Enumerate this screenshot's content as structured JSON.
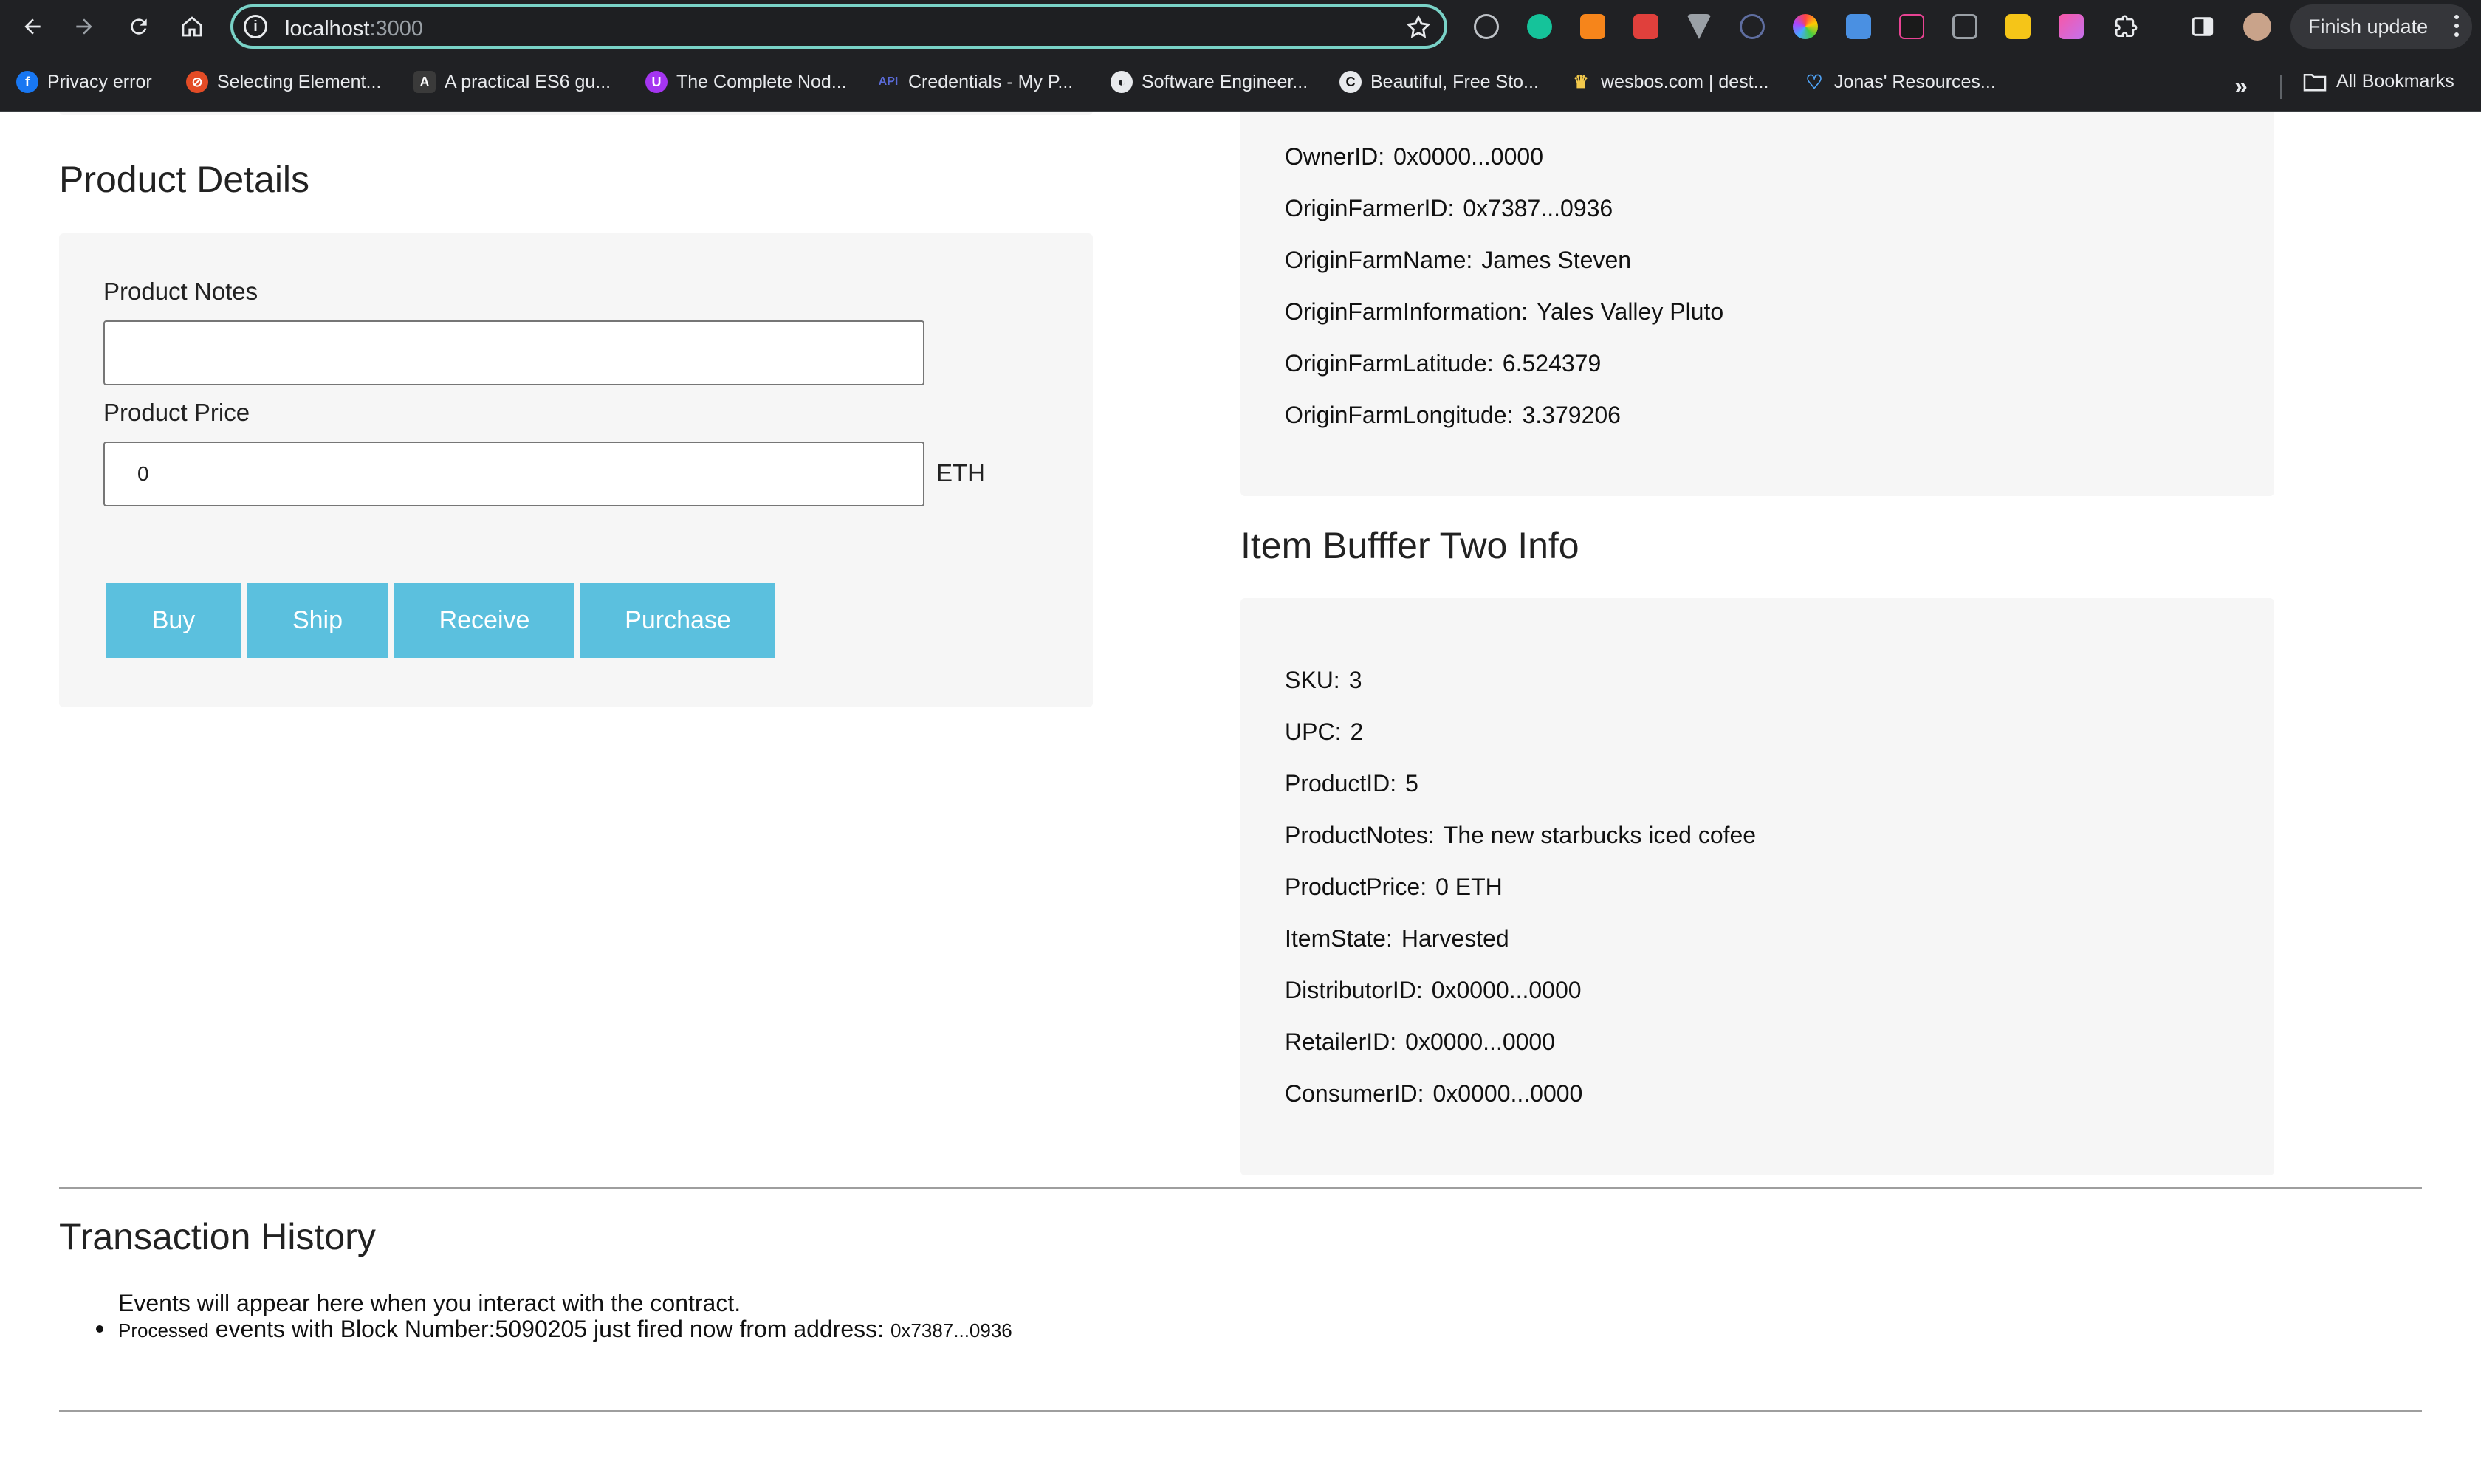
{
  "browser": {
    "url_host": "localhost",
    "url_port": ":3000",
    "finish_update_label": "Finish update",
    "bookmarks": [
      {
        "label": "Privacy error",
        "icon": "facebook-icon",
        "color": "#1877f2"
      },
      {
        "label": "Selecting Element...",
        "icon": "site-icon",
        "color": "#e34c26"
      },
      {
        "label": "A practical ES6 gu...",
        "icon": "site-icon",
        "color": "#3a3a3a"
      },
      {
        "label": "The Complete Nod...",
        "icon": "udemy-icon",
        "color": "#a435f0"
      },
      {
        "label": "Credentials - My P...",
        "icon": "api-icon",
        "color": "#5a6bd8"
      },
      {
        "label": "Software Engineer...",
        "icon": "globe-icon",
        "color": "#e8eaed"
      },
      {
        "label": "Beautiful, Free Sto...",
        "icon": "site-icon",
        "color": "#111111"
      },
      {
        "label": "wesbos.com | dest...",
        "icon": "crown-icon",
        "color": "#f2c94c"
      },
      {
        "label": "Jonas' Resources...",
        "icon": "heart-icon",
        "color": "#4fa3f7"
      }
    ],
    "all_bookmarks_label": "All Bookmarks"
  },
  "product_details": {
    "title": "Product Details",
    "notes_label": "Product Notes",
    "notes_value": "",
    "price_label": "Product Price",
    "price_value": "0",
    "price_unit": "ETH",
    "buttons": {
      "buy": "Buy",
      "ship": "Ship",
      "receive": "Receive",
      "purchase": "Purchase"
    }
  },
  "farm_info": {
    "owner_id": {
      "key": "OwnerID:",
      "value": "0x0000...0000"
    },
    "origin_farmer_id": {
      "key": "OriginFarmerID:",
      "value": "0x7387...0936"
    },
    "origin_farm_name": {
      "key": "OriginFarmName:",
      "value": "James Steven"
    },
    "origin_farm_information": {
      "key": "OriginFarmInformation:",
      "value": "Yales Valley Pluto"
    },
    "origin_farm_latitude": {
      "key": "OriginFarmLatitude:",
      "value": "6.524379"
    },
    "origin_farm_longitude": {
      "key": "OriginFarmLongitude:",
      "value": "3.379206"
    }
  },
  "buffer_two": {
    "title": "Item Bufffer Two Info",
    "sku": {
      "key": "SKU:",
      "value": "3"
    },
    "upc": {
      "key": "UPC:",
      "value": "2"
    },
    "product_id": {
      "key": "ProductID:",
      "value": "5"
    },
    "product_notes": {
      "key": "ProductNotes:",
      "value": "The new starbucks iced cofee"
    },
    "product_price": {
      "key": "ProductPrice:",
      "value": "0 ETH"
    },
    "item_state": {
      "key": "ItemState:",
      "value": "Harvested"
    },
    "distributor_id": {
      "key": "DistributorID:",
      "value": "0x0000...0000"
    },
    "retailer_id": {
      "key": "RetailerID:",
      "value": "0x0000...0000"
    },
    "consumer_id": {
      "key": "ConsumerID:",
      "value": "0x0000...0000"
    }
  },
  "transaction_history": {
    "title": "Transaction History",
    "intro": "Events will appear here when you interact with the contract.",
    "events": [
      {
        "prefix": "Processed",
        "text": "events with Block Number:5090205 just fired now from address:",
        "address": "0x7387...0936"
      }
    ]
  }
}
